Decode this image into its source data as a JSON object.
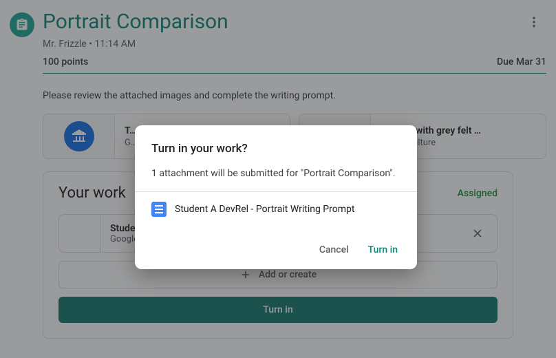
{
  "assignment": {
    "title": "Portrait Comparison",
    "teacher": "Mr. Frizzle",
    "posted_time": "11:14 AM",
    "points": "100 points",
    "due": "Due Mar 31",
    "description": "Please review the attached images and complete the writing prompt."
  },
  "attachments": [
    {
      "title": "T…",
      "source": "G…",
      "icon": "museum-icon"
    },
    {
      "title": "Portrait with grey felt …",
      "source": "Arts & Culture",
      "icon": "museum-icon"
    }
  ],
  "your_work": {
    "heading": "Your work",
    "status": "Assigned",
    "items": [
      {
        "name": "Studer…",
        "type": "Google …"
      }
    ],
    "add_label": "Add or create",
    "turn_in_label": "Turn in"
  },
  "dialog": {
    "title": "Turn in your work?",
    "body": "1 attachment will be submitted for \"Portrait Comparison\".",
    "attachment_name": "Student A DevRel - Portrait Writing Prompt",
    "cancel_label": "Cancel",
    "confirm_label": "Turn in"
  }
}
